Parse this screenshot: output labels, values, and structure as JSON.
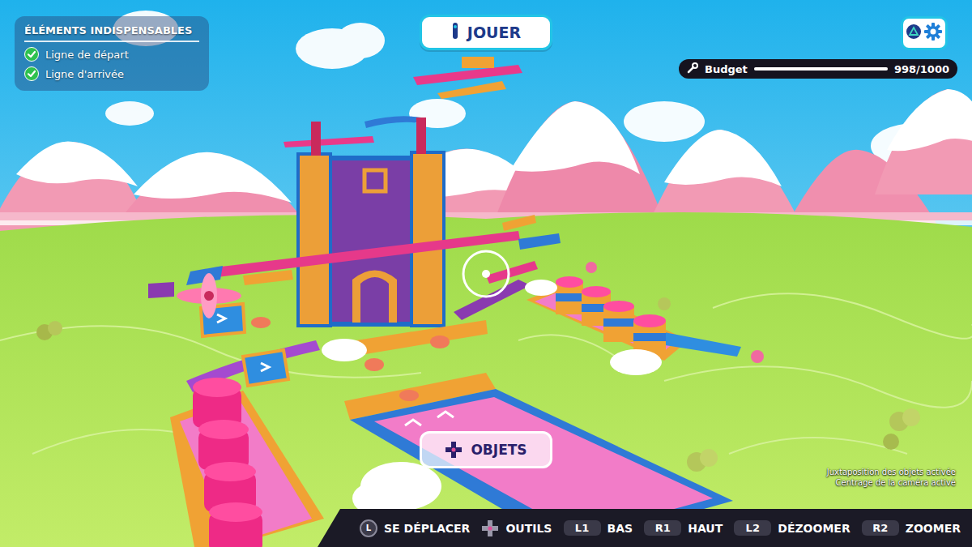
{
  "checklist": {
    "title": "ÉLÉMENTS INDISPENSABLES",
    "items": [
      {
        "label": "Ligne de départ",
        "checked": true
      },
      {
        "label": "Ligne d'arrivée",
        "checked": true
      }
    ]
  },
  "play_button": {
    "label": "JOUER"
  },
  "budget": {
    "label": "Budget",
    "level": 0.998,
    "reading": "998/1000"
  },
  "objects_button": {
    "label": "OBJETS"
  },
  "notices": [
    "Juxtaposition des objets activée",
    "Centrage de la caméra activé"
  ],
  "controls": [
    {
      "kind": "stick",
      "key": "L",
      "label": "SE DÉPLACER"
    },
    {
      "kind": "dpad",
      "label": "OUTILS"
    },
    {
      "kind": "button",
      "key": "L1",
      "label": "BAS"
    },
    {
      "kind": "button",
      "key": "R1",
      "label": "HAUT"
    },
    {
      "kind": "button",
      "key": "L2",
      "label": "DÉZOOMER"
    },
    {
      "kind": "button",
      "key": "R2",
      "label": "ZOOMER"
    }
  ]
}
